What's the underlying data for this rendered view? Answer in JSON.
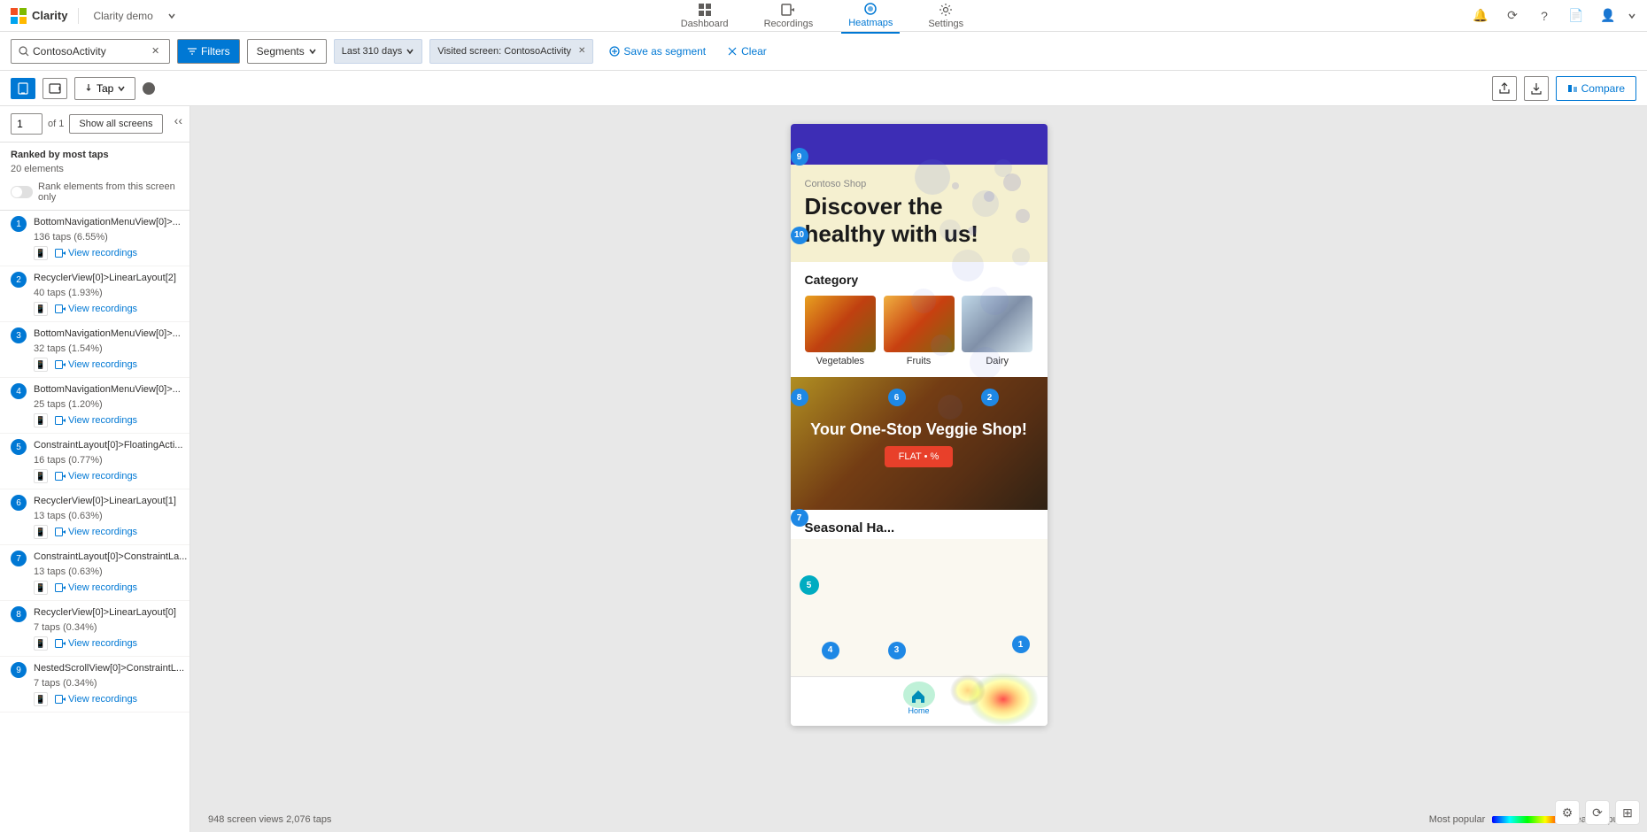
{
  "app": {
    "title": "Clarity",
    "demo_label": "Clarity demo"
  },
  "nav": {
    "items": [
      {
        "id": "dashboard",
        "label": "Dashboard",
        "active": false
      },
      {
        "id": "recordings",
        "label": "Recordings",
        "active": false
      },
      {
        "id": "heatmaps",
        "label": "Heatmaps",
        "active": true
      },
      {
        "id": "settings",
        "label": "Settings",
        "active": false
      }
    ]
  },
  "filters": {
    "search_value": "ContosoActivity",
    "filters_label": "Filters",
    "segments_label": "Segments",
    "date_label": "Last 310 days",
    "visited_screen_label": "Visited screen: ContosoActivity",
    "save_segment_label": "Save as segment",
    "clear_label": "Clear"
  },
  "view_controls": {
    "page_current": "1",
    "page_total": "1",
    "show_all_label": "Show all screens",
    "tap_label": "Tap",
    "share_label": "Share",
    "download_label": "Download",
    "compare_label": "Compare"
  },
  "sidebar": {
    "ranked_title": "Ranked by most taps",
    "elements_count": "20 elements",
    "rank_toggle_label": "Rank elements from this screen only",
    "items": [
      {
        "number": "1",
        "name": "BottomNavigationMenuView[0]>...",
        "taps": "136 taps (6.55%)",
        "has_phone": true,
        "has_recordings": true,
        "recordings_label": "View recordings"
      },
      {
        "number": "2",
        "name": "RecyclerView[0]>LinearLayout[2]",
        "taps": "40 taps (1.93%)",
        "has_phone": true,
        "has_recordings": true,
        "recordings_label": "View recordings"
      },
      {
        "number": "3",
        "name": "BottomNavigationMenuView[0]>...",
        "taps": "32 taps (1.54%)",
        "has_phone": true,
        "has_recordings": true,
        "recordings_label": "View recordings"
      },
      {
        "number": "4",
        "name": "BottomNavigationMenuView[0]>...",
        "taps": "25 taps (1.20%)",
        "has_phone": true,
        "has_recordings": true,
        "recordings_label": "View recordings"
      },
      {
        "number": "5",
        "name": "ConstraintLayout[0]>FloatingActi...",
        "taps": "16 taps (0.77%)",
        "has_phone": true,
        "has_recordings": true,
        "recordings_label": "View recordings"
      },
      {
        "number": "6",
        "name": "RecyclerView[0]>LinearLayout[1]",
        "taps": "13 taps (0.63%)",
        "has_phone": true,
        "has_recordings": true,
        "recordings_label": "View recordings"
      },
      {
        "number": "7",
        "name": "ConstraintLayout[0]>ConstraintLa...",
        "taps": "13 taps (0.63%)",
        "has_phone": true,
        "has_recordings": true,
        "recordings_label": "View recordings"
      },
      {
        "number": "8",
        "name": "RecyclerView[0]>LinearLayout[0]",
        "taps": "7 taps (0.34%)",
        "has_phone": true,
        "has_recordings": true,
        "recordings_label": "View recordings"
      },
      {
        "number": "9",
        "name": "NestedScrollView[0]>ConstraintL...",
        "taps": "7 taps (0.34%)",
        "has_phone": true,
        "has_recordings": true,
        "recordings_label": "View recordings"
      }
    ]
  },
  "heatmap": {
    "screen_name": "ContosoActivity",
    "bubbles": [
      {
        "id": "b1",
        "number": "9",
        "top": "7%",
        "left": "4%"
      },
      {
        "id": "b2",
        "number": "10",
        "top": "18%",
        "left": "4%"
      },
      {
        "id": "b3",
        "number": "8",
        "top": "48%",
        "left": "4%"
      },
      {
        "id": "b4",
        "number": "6",
        "top": "48%",
        "left": "38%"
      },
      {
        "id": "b5",
        "number": "2",
        "top": "48%",
        "left": "74%"
      },
      {
        "id": "b6",
        "number": "7",
        "top": "69%",
        "left": "4%"
      },
      {
        "id": "b7",
        "number": "5",
        "top": "78%",
        "left": "4%"
      },
      {
        "id": "b8",
        "number": "4",
        "top": "88%",
        "left": "13%"
      },
      {
        "id": "b9",
        "number": "3",
        "top": "88%",
        "left": "38%"
      },
      {
        "id": "b10",
        "number": "1",
        "top": "87%",
        "left": "86%"
      }
    ],
    "stats": {
      "screen_views": "948 screen views",
      "taps": "2,076 taps"
    },
    "legend": {
      "most_popular": "Most popular",
      "least_popular": "Least popular"
    }
  },
  "phone_screen": {
    "shop_label": "Contoso Shop",
    "headline_line1": "Discover the",
    "headline_line2": "healthy with us!",
    "category_title": "Category",
    "categories": [
      {
        "name": "Vegetables"
      },
      {
        "name": "Fruits"
      },
      {
        "name": "Dairy"
      }
    ],
    "banner_text": "Your One-Stop Veggie Shop!",
    "banner_cta": "FLAT • %",
    "seasonal_title": "Seasonal Ha...",
    "nav_home": "Home"
  }
}
